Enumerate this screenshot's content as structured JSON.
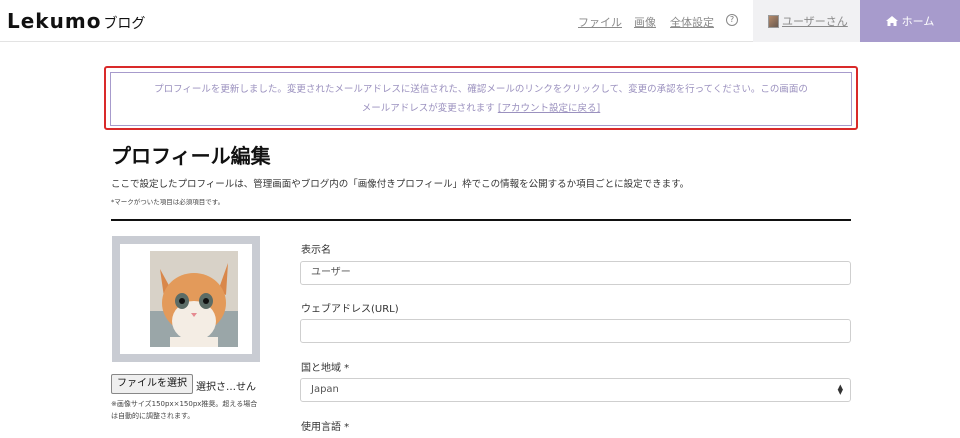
{
  "header": {
    "logo_main": "Lekumo",
    "logo_sub": "ブログ",
    "nav": [
      "ファイル",
      "画像",
      "全体設定"
    ],
    "help": "?",
    "user": "ユーザーさん",
    "home": "ホーム"
  },
  "notice": {
    "line1": "プロフィールを更新しました。変更されたメールアドレスに送信された、確認メールのリンクをクリックして、変更の承認を行ってください。この画面の",
    "line2_text": "メールアドレスが変更されます",
    "line2_link": "[アカウント設定に戻る]"
  },
  "page": {
    "title": "プロフィール編集",
    "description": "ここで設定したプロフィールは、管理画面やブログ内の「画像付きプロフィール」枠でこの情報を公開するか項目ごとに設定できます。",
    "note": "*マークがついた項目は必須項目です。"
  },
  "avatar": {
    "file_button": "ファイルを選択",
    "file_status": "選択さ…せん",
    "file_note": "※画像サイズ150px×150px推奨。超える場合は自動的に調整されます。"
  },
  "form": {
    "display_name_label": "表示名",
    "display_name_value": "ユーザー",
    "url_label": "ウェブアドレス(URL)",
    "url_value": "",
    "country_label": "国と地域 *",
    "country_value": "Japan",
    "language_label": "使用言語 *"
  },
  "colors": {
    "accent": "#a79bcc",
    "highlight": "#d92a2a"
  }
}
